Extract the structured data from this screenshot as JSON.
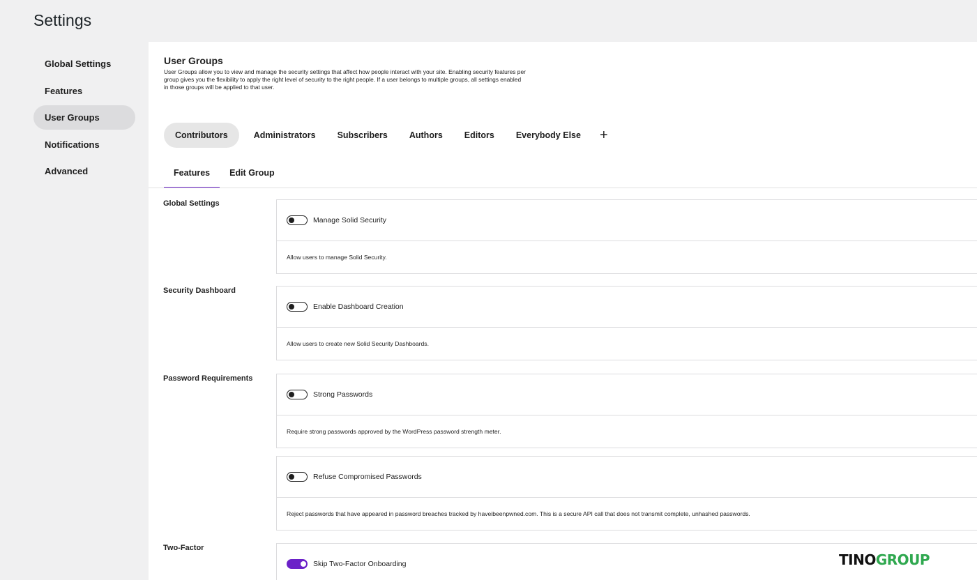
{
  "page": {
    "title": "Settings"
  },
  "sidebar": {
    "items": [
      {
        "label": "Global Settings",
        "active": false
      },
      {
        "label": "Features",
        "active": false
      },
      {
        "label": "User Groups",
        "active": true
      },
      {
        "label": "Notifications",
        "active": false
      },
      {
        "label": "Advanced",
        "active": false
      }
    ]
  },
  "user_groups": {
    "title": "User Groups",
    "description": "User Groups allow you to view and manage the security settings that affect how people interact with your site. Enabling security features per group gives you the flexibility to apply the right level of security to the right people. If a user belongs to multiple groups, all settings enabled in those groups will be applied to that user.",
    "groups": [
      "Contributors",
      "Administrators",
      "Subscribers",
      "Authors",
      "Editors",
      "Everybody Else"
    ],
    "active_group": "Contributors",
    "add_label": "+"
  },
  "tabs": {
    "features": "Features",
    "edit_group": "Edit Group",
    "active": "Features"
  },
  "sections": [
    {
      "label": "Global Settings",
      "settings": [
        {
          "label": "Manage Solid Security",
          "description": "Allow users to manage Solid Security.",
          "enabled": false
        }
      ]
    },
    {
      "label": "Security Dashboard",
      "settings": [
        {
          "label": "Enable Dashboard Creation",
          "description": "Allow users to create new Solid Security Dashboards.",
          "enabled": false
        }
      ]
    },
    {
      "label": "Password Requirements",
      "settings": [
        {
          "label": "Strong Passwords",
          "description": "Require strong passwords approved by the WordPress password strength meter.",
          "enabled": false
        },
        {
          "label": "Refuse Compromised Passwords",
          "description": "Reject passwords that have appeared in password breaches tracked by haveibeenpwned.com. This is a secure API call that does not transmit complete, unhashed passwords.",
          "enabled": false
        }
      ]
    },
    {
      "label": "Two-Factor",
      "settings": [
        {
          "label": "Skip Two-Factor Onboarding",
          "enabled": true
        }
      ]
    }
  ],
  "watermark": {
    "part1": "TINO",
    "part2": "GROUP"
  },
  "colors": {
    "accent": "#6b21c8",
    "page_bg": "#f0f0f1",
    "panel_bg": "#ffffff",
    "watermark_green": "#2fa84f"
  }
}
